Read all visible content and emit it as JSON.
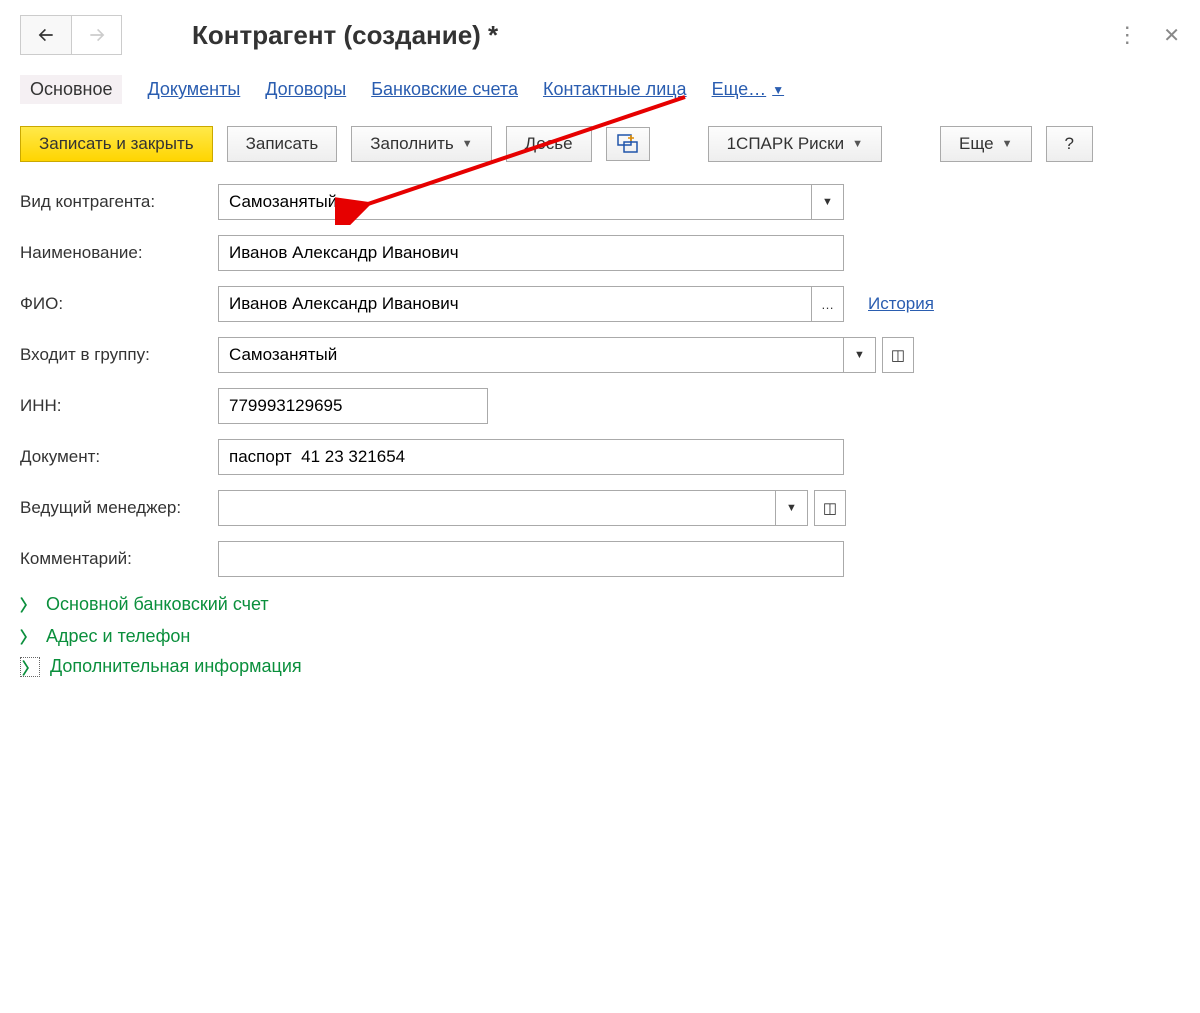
{
  "header": {
    "title": "Контрагент (создание) *"
  },
  "tabs": {
    "items": [
      {
        "label": "Основное",
        "active": true
      },
      {
        "label": "Документы"
      },
      {
        "label": "Договоры"
      },
      {
        "label": "Банковские счета"
      },
      {
        "label": "Контактные лица"
      }
    ],
    "more_label": "Еще…"
  },
  "toolbar": {
    "save_close": "Записать и закрыть",
    "save": "Записать",
    "fill": "Заполнить",
    "dossier": "Досье",
    "spark": "1СПАРК Риски",
    "more": "Еще",
    "help": "?"
  },
  "form": {
    "counterparty_type": {
      "label": "Вид контрагента:",
      "value": "Самозанятый"
    },
    "name": {
      "label": "Наименование:",
      "value": "Иванов Александр Иванович"
    },
    "fio": {
      "label": "ФИО:",
      "value": "Иванов Александр Иванович",
      "history_link": "История"
    },
    "group": {
      "label": "Входит в группу:",
      "value": "Самозанятый"
    },
    "inn": {
      "label": "ИНН:",
      "value": "779993129695"
    },
    "document": {
      "label": "Документ:",
      "value": "паспорт  41 23 321654"
    },
    "manager": {
      "label": "Ведущий менеджер:",
      "value": ""
    },
    "comment": {
      "label": "Комментарий:",
      "value": ""
    }
  },
  "collapsibles": {
    "bank_account": "Основной банковский счет",
    "address_phone": "Адрес и телефон",
    "additional_info": "Дополнительная информация"
  }
}
